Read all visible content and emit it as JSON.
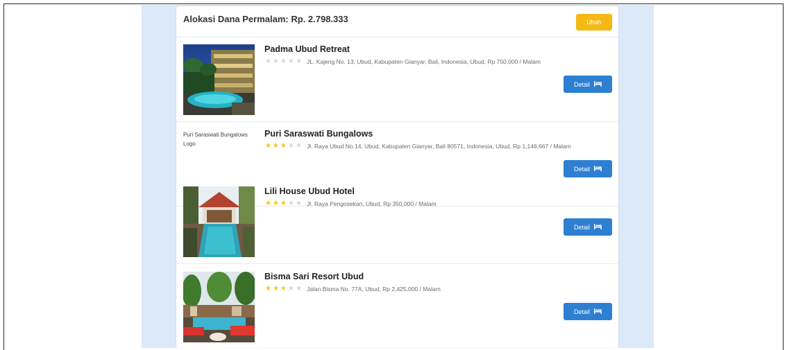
{
  "header": {
    "title": "Alokasi Dana Permalam: Rp. 2.798.333",
    "change_label": "Ubah"
  },
  "hotels": [
    {
      "name": "Padma Ubud Retreat",
      "rating": 0,
      "info": "JL. Kajeng No. 13, Ubud, Kabupaten Gianyar, Bali, Indonesia, Ubud,  Rp 750,000 / Malam",
      "image_alt": "",
      "detail_label": "Detail"
    },
    {
      "name": "Puri Saraswati Bungalows",
      "rating": 3,
      "info": "Jl. Raya Ubud No.14, Ubud, Kabupaten Gianyar, Bali 80571, Indonesia, Ubud,  Rp 1,146,667 / Malam",
      "image_alt": "Puri Saraswati Bungalows Logo",
      "detail_label": "Detail"
    },
    {
      "name": "Lili House Ubud Hotel",
      "rating": 3,
      "info": "Jl. Raya Pengosekan, Ubud,  Rp 350,000 / Malam",
      "image_alt": "",
      "detail_label": "Detail"
    },
    {
      "name": "Bisma Sari Resort Ubud",
      "rating": 3,
      "info": "Jalan Bisma No. 77A, Ubud,  Rp 2,425,000 / Malam",
      "image_alt": "",
      "detail_label": "Detail"
    }
  ],
  "max_rating": 5,
  "colors": {
    "page_bg": "#dbe9f9",
    "accent_yellow": "#f5b915",
    "detail_blue": "#2d7fd2",
    "star_on": "#f5c518",
    "star_off": "#d8d8d8"
  },
  "icons": {
    "detail": "bed-icon",
    "rating": "star-icon"
  }
}
